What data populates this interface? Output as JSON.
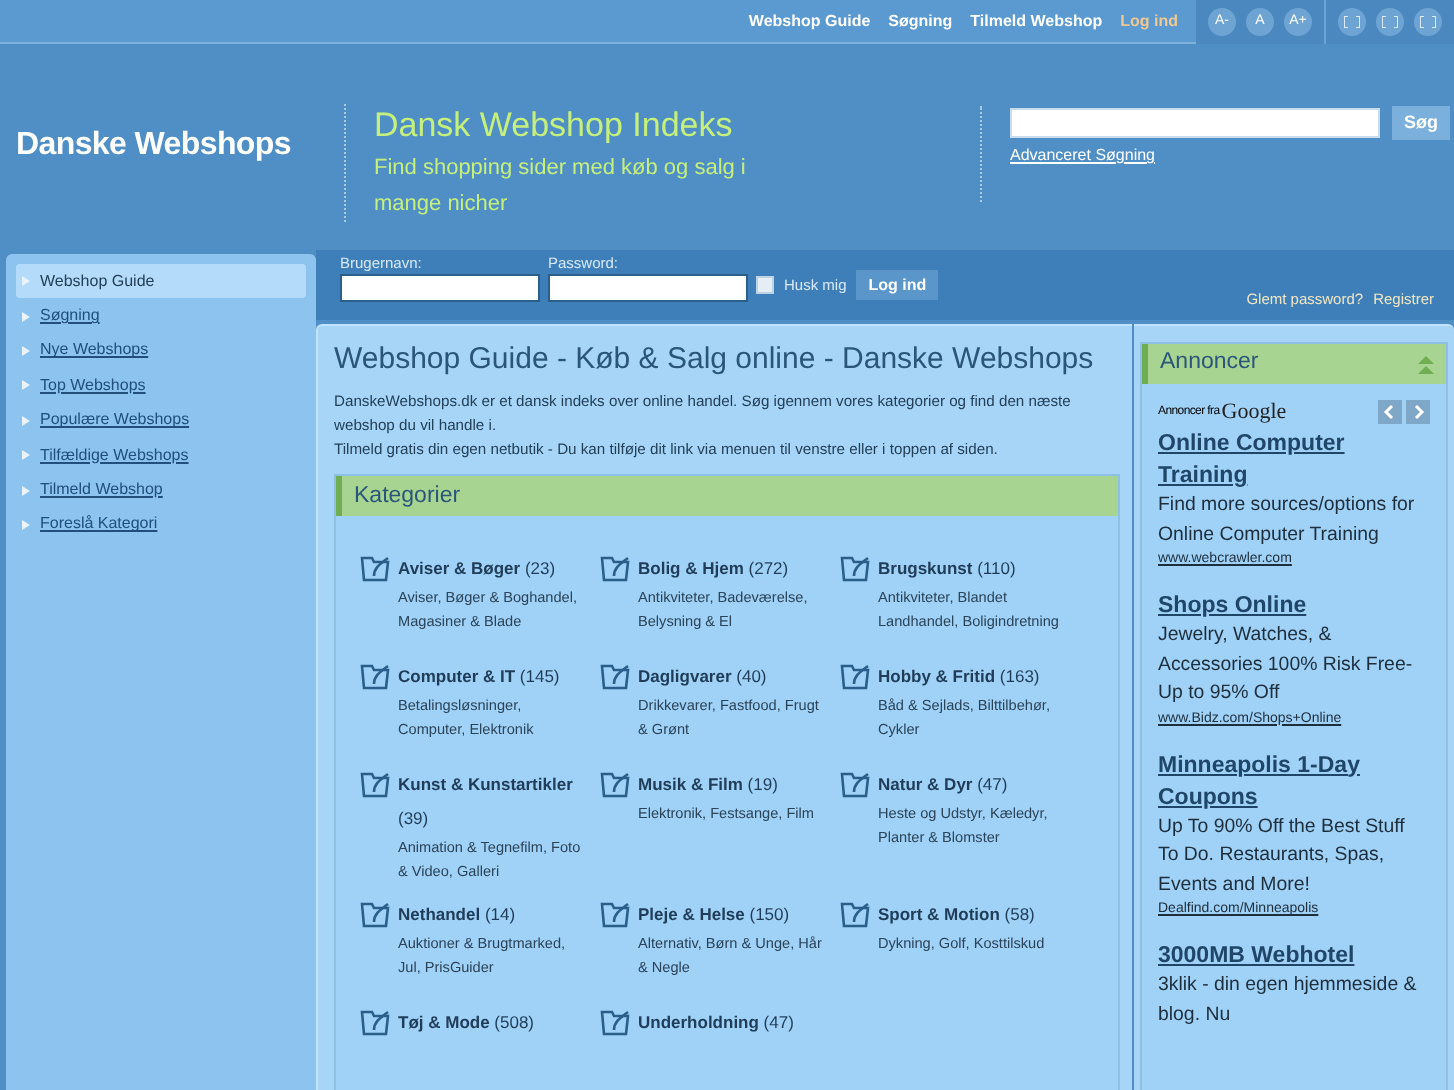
{
  "top_nav": [
    {
      "label": "Webshop Guide",
      "highlighted": false
    },
    {
      "label": "Søgning",
      "highlighted": false
    },
    {
      "label": "Tilmeld Webshop",
      "highlighted": false
    },
    {
      "label": "Log ind",
      "highlighted": true
    }
  ],
  "font_buttons": [
    "A-",
    "A",
    "A+"
  ],
  "logo": "Danske Webshops",
  "site_title": "Dansk Webshop Indeks",
  "tagline": "Find shopping sider med køb og salg i mange nicher",
  "search": {
    "button": "Søg",
    "advanced_link": "Advanceret Søgning"
  },
  "sidebar": {
    "items": [
      {
        "label": "Webshop Guide",
        "selected": true
      },
      {
        "label": "Søgning",
        "selected": false
      },
      {
        "label": "Nye Webshops",
        "selected": false
      },
      {
        "label": "Top Webshops",
        "selected": false
      },
      {
        "label": "Populære Webshops",
        "selected": false
      },
      {
        "label": "Tilfældige Webshops",
        "selected": false
      },
      {
        "label": "Tilmeld Webshop",
        "selected": false
      },
      {
        "label": "Foreslå Kategori",
        "selected": false
      }
    ]
  },
  "login": {
    "username_label": "Brugernavn:",
    "password_label": "Password:",
    "remember": {
      "label": "Husk mig",
      "checked": false
    },
    "button": "Log ind",
    "forgot_link": "Glemt password?",
    "register_link": "Registrer"
  },
  "main": {
    "title": "Webshop Guide - Køb & Salg online - Danske Webshops",
    "intro": [
      "DanskeWebshops.dk er et dansk indeks over online handel. Søg igennem vores kategorier og find den næste webshop du vil handle i.",
      "Tilmeld gratis din egen netbutik - Du kan tilføje dit link via menuen til venstre eller i toppen af siden."
    ],
    "categories_title": "Kategorier",
    "categories": [
      {
        "name": "Aviser & Bøger",
        "count": "(23)",
        "subs": "Aviser, Bøger & Boghandel, Magasiner & Blade"
      },
      {
        "name": "Bolig & Hjem",
        "count": "(272)",
        "subs": "Antikviteter, Badeværelse, Belysning & El"
      },
      {
        "name": "Brugskunst",
        "count": "(110)",
        "subs": "Antikviteter, Blandet Landhandel, Boligindretning"
      },
      {
        "name": "Computer & IT",
        "count": "(145)",
        "subs": "Betalingsløsninger, Computer, Elektronik"
      },
      {
        "name": "Dagligvarer",
        "count": "(40)",
        "subs": "Drikkevarer, Fastfood, Frugt & Grønt"
      },
      {
        "name": "Hobby & Fritid",
        "count": "(163)",
        "subs": "Båd & Sejlads, Bilttilbehør, Cykler"
      },
      {
        "name": "Kunst & Kunstartikler",
        "count": "(39)",
        "subs": "Animation & Tegnefilm, Foto & Video, Galleri"
      },
      {
        "name": "Musik & Film",
        "count": "(19)",
        "subs": "Elektronik, Festsange, Film"
      },
      {
        "name": "Natur & Dyr",
        "count": "(47)",
        "subs": "Heste og Udstyr, Kæledyr, Planter & Blomster"
      },
      {
        "name": "Nethandel",
        "count": "(14)",
        "subs": "Auktioner & Brugtmarked, Jul, PrisGuider"
      },
      {
        "name": "Pleje & Helse",
        "count": "(150)",
        "subs": "Alternativ, Børn & Unge, Hår & Negle"
      },
      {
        "name": "Sport & Motion",
        "count": "(58)",
        "subs": "Dykning, Golf, Kosttilskud"
      },
      {
        "name": "Tøj & Mode",
        "count": "(508)"
      },
      {
        "name": "Underholdning",
        "count": "(47)"
      }
    ]
  },
  "ads": {
    "title": "Annoncer",
    "source_prefix": "Annoncer fra",
    "source_brand": "Google",
    "items": [
      {
        "title": "Online Computer Training",
        "text": "Find more sources/options for Online Computer Training",
        "url": "www.webcrawler.com"
      },
      {
        "title": "Shops Online",
        "text": "Jewelry, Watches, & Accessories 100% Risk Free- Up to 95% Off",
        "url": "www.Bidz.com/Shops+Online"
      },
      {
        "title": "Minneapolis 1-Day Coupons",
        "text": "Up To 90% Off the Best Stuff To Do. Restaurants, Spas, Events and More!",
        "url": "Dealfind.com/Minneapolis"
      },
      {
        "title": "3000MB Webhotel",
        "text": "3klik - din egen hjemmeside & blog. Nu"
      }
    ]
  }
}
